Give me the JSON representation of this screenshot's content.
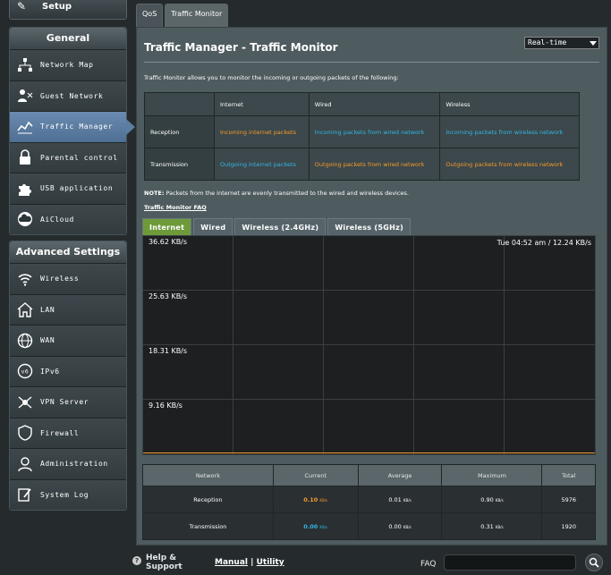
{
  "sidebar": {
    "setup_label": "Setup",
    "general_title": "General",
    "general_items": [
      {
        "label": "Network Map",
        "icon": "network-map-icon"
      },
      {
        "label": "Guest Network",
        "icon": "guest-network-icon"
      },
      {
        "label": "Traffic Manager",
        "icon": "traffic-manager-icon"
      },
      {
        "label": "Parental control",
        "icon": "lock-icon"
      },
      {
        "label": "USB application",
        "icon": "puzzle-icon"
      },
      {
        "label": "AiCloud",
        "icon": "cloud-icon"
      }
    ],
    "advanced_title": "Advanced Settings",
    "advanced_items": [
      {
        "label": "Wireless",
        "icon": "wifi-icon"
      },
      {
        "label": "LAN",
        "icon": "home-icon"
      },
      {
        "label": "WAN",
        "icon": "globe-icon"
      },
      {
        "label": "IPv6",
        "icon": "ipv6-icon"
      },
      {
        "label": "VPN Server",
        "icon": "vpn-icon"
      },
      {
        "label": "Firewall",
        "icon": "shield-icon"
      },
      {
        "label": "Administration",
        "icon": "user-icon"
      },
      {
        "label": "System Log",
        "icon": "log-icon"
      }
    ]
  },
  "top_tabs": [
    "QoS",
    "Traffic Monitor"
  ],
  "main": {
    "title": "Traffic Manager - Traffic Monitor",
    "mode_select": "Real-time",
    "description": "Traffic Monitor allows you to monitor the incoming or outgoing packets of the following:",
    "info_table": {
      "headers": [
        "Internet",
        "Wired",
        "Wireless"
      ],
      "rows": [
        {
          "label": "Reception",
          "internet": "Incoming internet packets",
          "wired": "Incoming packets from wired network",
          "wireless": "Incoming packets from wireless network"
        },
        {
          "label": "Transmission",
          "internet": "Outgoing internet packets",
          "wired": "Outgoing packets from wired network",
          "wireless": "Outgoing packets from wireless network"
        }
      ]
    },
    "note_bold": "NOTE:",
    "note": " Packets from the internet are evenly transmitted to the wired and wireless devices.",
    "faq_link": "Traffic Monitor FAQ",
    "graph_tabs": [
      "Internet",
      "Wired",
      "Wireless (2.4GHz)",
      "Wireless (5GHz)"
    ],
    "graph": {
      "y_labels": [
        "36.62 KB/s",
        "25.63 KB/s",
        "18.31 KB/s",
        "9.16 KB/s"
      ],
      "time_readout": "Tue 04:52 am / 12.24 KB/s"
    },
    "stats": {
      "headers": [
        "Network",
        "Current",
        "Average",
        "Maximum",
        "Total"
      ],
      "unit": "KB/s",
      "rows": [
        {
          "network": "Reception",
          "current": "0.10",
          "average": "0.01",
          "maximum": "0.90",
          "total": "5976"
        },
        {
          "network": "Transmission",
          "current": "0.00",
          "average": "0.00",
          "maximum": "0.31",
          "total": "1920"
        }
      ]
    }
  },
  "footer": {
    "help_line1": "Help &",
    "help_line2": "Support",
    "manual": "Manual",
    "separator": "|",
    "utility": "Utility",
    "faq": "FAQ"
  },
  "colors": {
    "accent_orange": "#f79a2e",
    "accent_blue": "#34b6e5",
    "active_tab_green": "#6e9a3a"
  }
}
